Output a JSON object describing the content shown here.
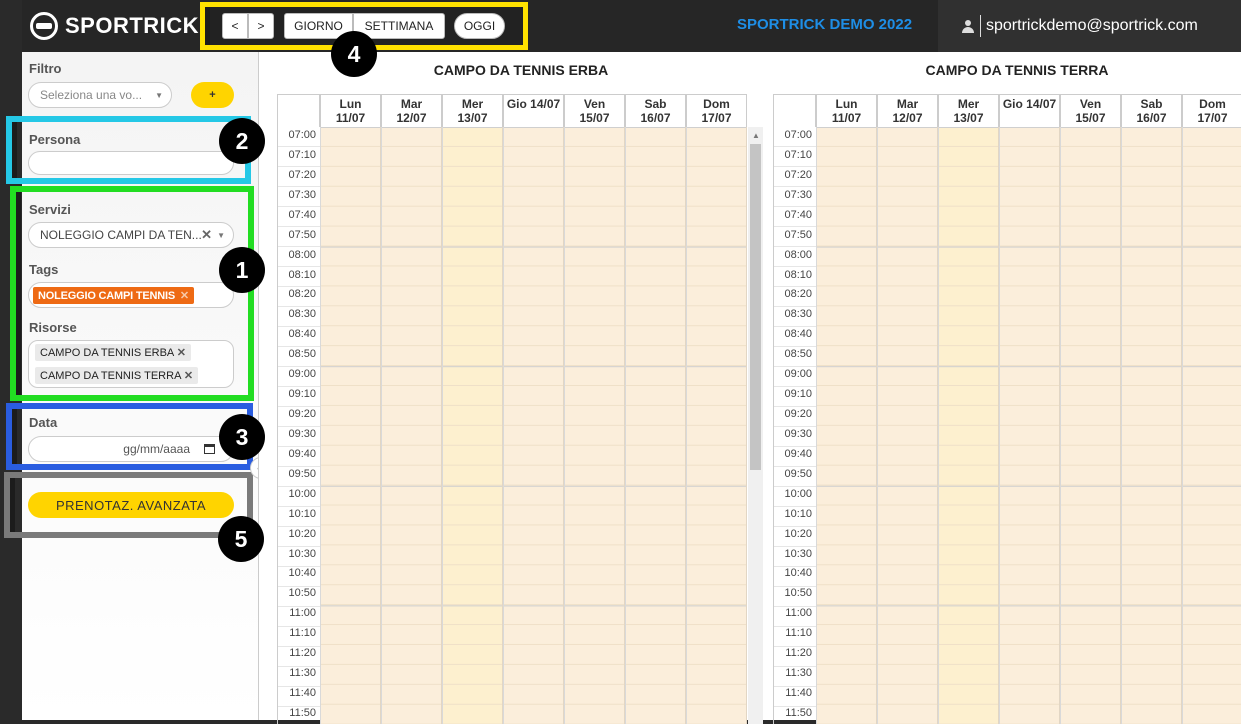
{
  "header": {
    "logo_text": "SPORTRICK",
    "nav": {
      "prev": "<",
      "next": ">",
      "giorno": "GIORNO",
      "settimana": "SETTIMANA",
      "oggi": "OGGI"
    },
    "demo_title": "SPORTRICK DEMO 2022",
    "user_email": "sportrickdemo@sportrick.com"
  },
  "sidebar": {
    "filtro_label": "Filtro",
    "filtro_placeholder": "Seleziona una vo...",
    "add_label": "+",
    "persona_label": "Persona",
    "persona_value": "",
    "servizi_label": "Servizi",
    "servizi_value": "NOLEGGIO CAMPI DA TEN...",
    "tags_label": "Tags",
    "tags": [
      "NOLEGGIO CAMPI TENNIS"
    ],
    "risorse_label": "Risorse",
    "risorse": [
      "CAMPO DA TENNIS ERBA",
      "CAMPO DA TENNIS TERRA"
    ],
    "data_label": "Data",
    "data_placeholder": "gg/mm/aaaa",
    "advanced_button": "PRENOTAZ. AVANZATA"
  },
  "markers": [
    "1",
    "2",
    "3",
    "4",
    "5"
  ],
  "calendars": [
    {
      "title": "CAMPO DA TENNIS ERBA"
    },
    {
      "title": "CAMPO DA TENNIS TERRA"
    }
  ],
  "days": [
    {
      "d": "Lun",
      "date": "11/07",
      "today": false
    },
    {
      "d": "Mar",
      "date": "12/07",
      "today": false
    },
    {
      "d": "Mer",
      "date": "13/07",
      "today": true
    },
    {
      "d": "Gio 14/07",
      "date": "",
      "today": false
    },
    {
      "d": "Ven",
      "date": "15/07",
      "today": false
    },
    {
      "d": "Sab",
      "date": "16/07",
      "today": false
    },
    {
      "d": "Dom",
      "date": "17/07",
      "today": false
    }
  ],
  "times": [
    "07:00",
    "07:10",
    "07:20",
    "07:30",
    "07:40",
    "07:50",
    "08:00",
    "08:10",
    "08:20",
    "08:30",
    "08:40",
    "08:50",
    "09:00",
    "09:10",
    "09:20",
    "09:30",
    "09:40",
    "09:50",
    "10:00",
    "10:10",
    "10:20",
    "10:30",
    "10:40",
    "10:50",
    "11:00",
    "11:10",
    "11:20",
    "11:30",
    "11:40",
    "11:50"
  ],
  "colors": {
    "accent_yellow": "#ffd400",
    "marker4_border": "#ffe100",
    "marker2_border": "#25c8e6",
    "marker1_border": "#22dd22",
    "marker3_border": "#2a5de0",
    "marker5_border": "#7a7a7a",
    "tag_orange": "#ee6a14",
    "slot_bg": "#fbeedb",
    "today_bg": "#fdf0cf",
    "demo_blue": "#1e8ee6"
  }
}
